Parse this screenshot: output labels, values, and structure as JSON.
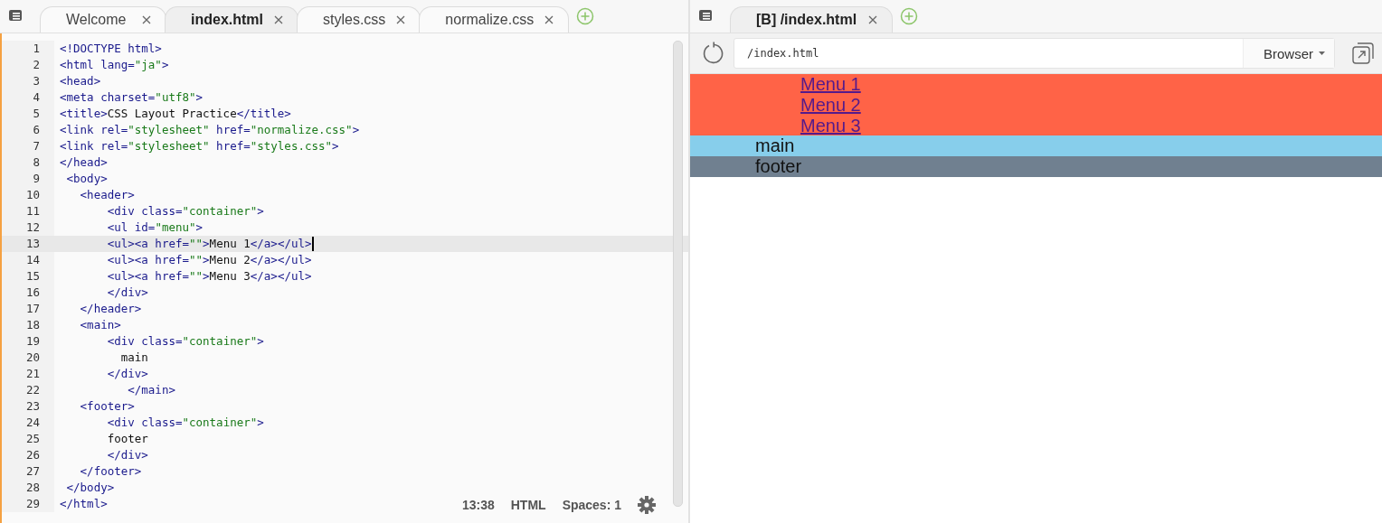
{
  "editor": {
    "tabs": [
      {
        "label": "Welcome",
        "selected": false
      },
      {
        "label": "index.html",
        "selected": true
      },
      {
        "label": "styles.css",
        "selected": false
      },
      {
        "label": "normalize.css",
        "selected": false
      }
    ],
    "lines": [
      {
        "number": "1",
        "code": "<!DOCTYPE html>",
        "current": false
      },
      {
        "number": "2",
        "code": "<html lang=\"ja\">",
        "current": false
      },
      {
        "number": "3",
        "code": "<head>",
        "current": false
      },
      {
        "number": "4",
        "code": "<meta charset=\"utf8\">",
        "current": false
      },
      {
        "number": "5",
        "code": "<title>CSS Layout Practice</title>",
        "current": false
      },
      {
        "number": "6",
        "code": "<link rel=\"stylesheet\" href=\"normalize.css\">",
        "current": false
      },
      {
        "number": "7",
        "code": "<link rel=\"stylesheet\" href=\"styles.css\">",
        "current": false
      },
      {
        "number": "8",
        "code": "</head>",
        "current": false
      },
      {
        "number": "9",
        "code": " <body>",
        "current": false
      },
      {
        "number": "10",
        "code": "   <header>",
        "current": false
      },
      {
        "number": "11",
        "code": "       <div class=\"container\">",
        "current": false
      },
      {
        "number": "12",
        "code": "       <ul id=\"menu\">",
        "current": false
      },
      {
        "number": "13",
        "code": "       <ul><a href=\"\">Menu 1</a></ul>",
        "current": true
      },
      {
        "number": "14",
        "code": "       <ul><a href=\"\">Menu 2</a></ul>",
        "current": false
      },
      {
        "number": "15",
        "code": "       <ul><a href=\"\">Menu 3</a></ul>",
        "current": false
      },
      {
        "number": "16",
        "code": "       </div>",
        "current": false
      },
      {
        "number": "17",
        "code": "   </header>",
        "current": false
      },
      {
        "number": "18",
        "code": "   <main>",
        "current": false
      },
      {
        "number": "19",
        "code": "       <div class=\"container\">",
        "current": false
      },
      {
        "number": "20",
        "code": "         main",
        "current": false
      },
      {
        "number": "21",
        "code": "       </div>",
        "current": false
      },
      {
        "number": "22",
        "code": "          </main>",
        "current": false
      },
      {
        "number": "23",
        "code": "   <footer>",
        "current": false
      },
      {
        "number": "24",
        "code": "       <div class=\"container\">",
        "current": false
      },
      {
        "number": "25",
        "code": "       footer",
        "current": false
      },
      {
        "number": "26",
        "code": "       </div>",
        "current": false
      },
      {
        "number": "27",
        "code": "   </footer>",
        "current": false
      },
      {
        "number": "28",
        "code": " </body>",
        "current": false
      },
      {
        "number": "29",
        "code": "</html>",
        "current": false
      }
    ],
    "status_bar": {
      "cursor": "13:38",
      "language": "HTML",
      "indent": "Spaces: 1"
    }
  },
  "preview": {
    "tabs": [
      {
        "label": "[B] /index.html",
        "selected": true
      }
    ],
    "address": "/index.html",
    "mode": "Browser",
    "sections": [
      {
        "kind": "header",
        "color": "#ff6347",
        "links": [
          "Menu 1",
          "Menu 2",
          "Menu 3"
        ]
      },
      {
        "kind": "main",
        "color": "#87ceeb",
        "text": "main"
      },
      {
        "kind": "footer",
        "color": "#708090",
        "text": "footer"
      }
    ]
  }
}
